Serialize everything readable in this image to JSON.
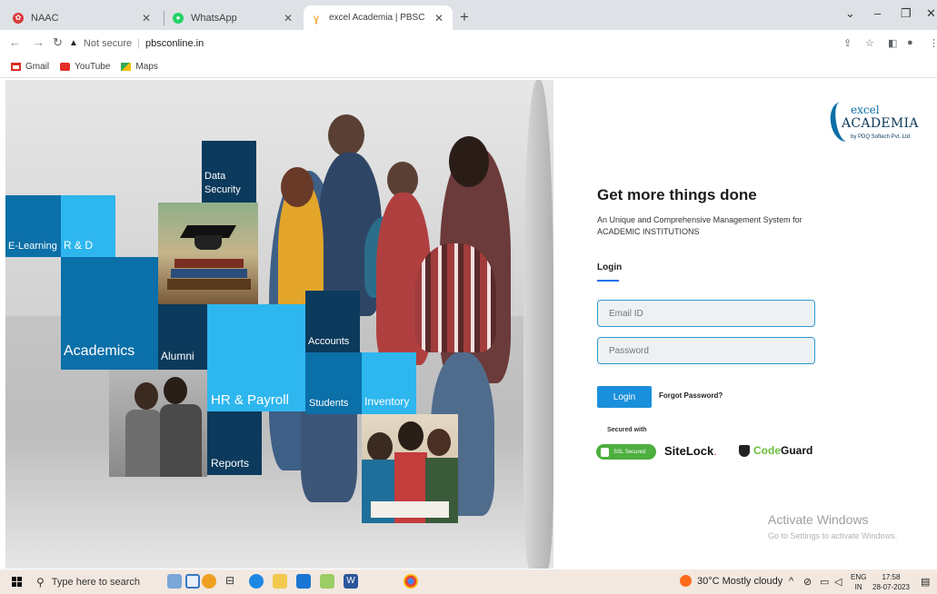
{
  "browser": {
    "tabs": [
      {
        "title": "NAAC",
        "favicon": "naac-icon"
      },
      {
        "title": "WhatsApp",
        "favicon": "whatsapp-icon"
      },
      {
        "title": "excel Academia | PBSC",
        "favicon": "academia-icon"
      }
    ],
    "new_tab_glyph": "+",
    "address": {
      "security": "Not secure",
      "url": "pbsconline.in"
    },
    "bookmarks": [
      {
        "label": "Gmail",
        "icon": "gmail-icon"
      },
      {
        "label": "YouTube",
        "icon": "youtube-icon"
      },
      {
        "label": "Maps",
        "icon": "maps-icon"
      }
    ]
  },
  "hero": {
    "tiles": {
      "elearning": "E-Learning",
      "rd": "R & D",
      "data_security": "Data\nSecurity",
      "academics": "Academics",
      "alumni": "Alumni",
      "accounts": "Accounts",
      "hr_payroll": "HR & Payroll",
      "students": "Students",
      "inventory": "Inventory",
      "reports": "Reports"
    }
  },
  "logo": {
    "line1": "excel",
    "line2": "ACADEMIA",
    "line3": "by PDQ Softech Pvt. Ltd"
  },
  "login": {
    "title": "Get more things done",
    "subtitle": "An Unique and Comprehensive Management System for ACADEMIC INSTITUTIONS",
    "section": "Login",
    "email_placeholder": "Email ID",
    "password_placeholder": "Password",
    "button": "Login",
    "forgot": "Forgot Password?",
    "secured_with": "Secured with",
    "ssl": "SSL Secured",
    "sitelock": "SiteLock",
    "codeguard_a": "Code",
    "codeguard_b": "Guard"
  },
  "watermark": {
    "line1": "Activate Windows",
    "line2": "Go to Settings to activate Windows."
  },
  "taskbar": {
    "search": "Type here to search",
    "weather": "30°C  Mostly cloudy",
    "lang_a": "ENG",
    "lang_b": "IN",
    "time": "17:58",
    "date": "28-07-2023"
  },
  "colors": {
    "brand_dark": "#0b3a5c",
    "brand_mid": "#0b6fa8",
    "brand_light": "#1aa3e6",
    "button": "#1a8fdb"
  }
}
